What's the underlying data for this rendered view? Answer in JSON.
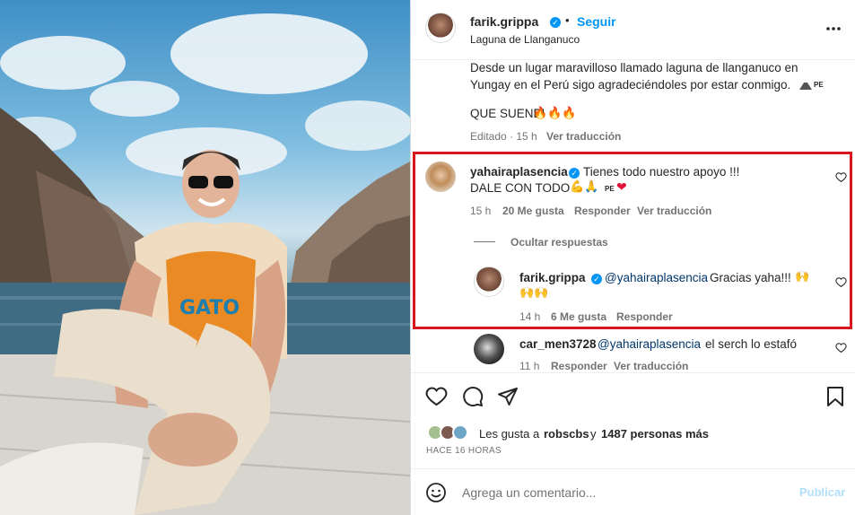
{
  "header": {
    "username": "farik.grippa",
    "dot": "•",
    "follow_label": "Seguir",
    "location": "Laguna de Llanganuco",
    "more_icon": "more-horizontal-icon"
  },
  "caption": {
    "text_line1": "Desde un lugar maravilloso llamado laguna de llanganuco en",
    "text_line2": "Yungay en el Perú sigo agradeciéndoles por estar conmigo.",
    "flag_code": "PE",
    "line3": "QUE SUENE!",
    "fire": "🔥🔥🔥",
    "edited": "Editado · 15 h",
    "translate": "Ver traducción"
  },
  "comment1": {
    "username": "yahairaplasencia",
    "text_line1": "Tienes todo nuestro apoyo !!!",
    "text_line2": "DALE CON TODO",
    "emoji": "💪🙏",
    "flag_code": "PE",
    "heart_emoji": "❤",
    "time": "15 h",
    "likes": "20 Me gusta",
    "reply": "Responder",
    "translate": "Ver traducción",
    "hide_replies": "Ocultar respuestas"
  },
  "reply1": {
    "username": "farik.grippa",
    "mention": "@yahairaplasencia",
    "text": "Gracias yaha!!!",
    "emoji_line1": "🙌",
    "emoji_line2": "🙌🙌",
    "time": "14 h",
    "likes": "6 Me gusta",
    "reply": "Responder"
  },
  "comment2": {
    "username": "car_men3728",
    "mention": "@yahairaplasencia",
    "text": "el serch lo estafó",
    "time": "11 h",
    "reply": "Responder",
    "translate": "Ver traducción"
  },
  "likes": {
    "prefix": "Les gusta a",
    "user": "robscbs",
    "conj": "y",
    "count": "1487 personas más",
    "timestamp": "HACE 16 HORAS"
  },
  "comment_box": {
    "placeholder": "Agrega un comentario...",
    "publish": "Publicar"
  },
  "colors": {
    "accent": "#0095f6",
    "highlight_box": "#d9161c",
    "heart_red": "#ed4956"
  }
}
